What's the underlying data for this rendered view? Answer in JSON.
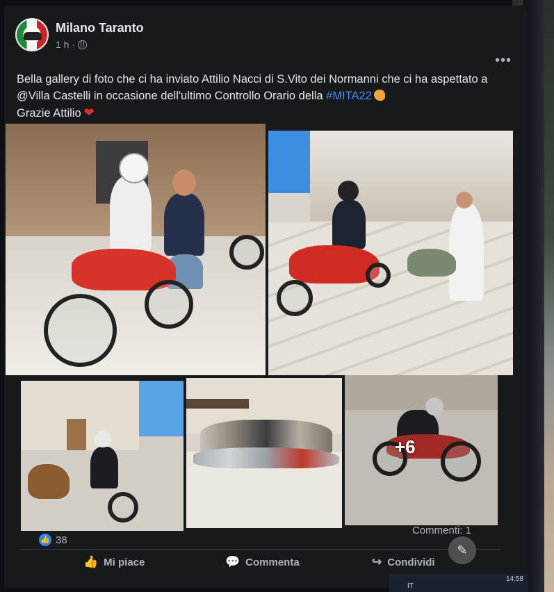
{
  "post": {
    "page_name": "Milano Taranto",
    "time": "1 h",
    "separator": "·",
    "more": "•••",
    "text_part1": "Bella gallery di foto che ci ha inviato Attilio Nacci di S.Vito dei Normanni che ci ha aspettato a @Villa Castelli in occasione dell'ultimo Controllo Orario della ",
    "hashtag": "#MITA22",
    "text_part2": "Grazie Attilio"
  },
  "gallery": {
    "more_photos": "+6"
  },
  "stats": {
    "likes": "38",
    "comments": "Commenti: 1"
  },
  "actions": {
    "like": "Mi piace",
    "comment": "Commenta",
    "share": "Condividi"
  },
  "taskbar": {
    "lang": "IT",
    "time": "14:58"
  },
  "colors": {
    "background": "#18191c",
    "hashtag": "#4a8cff",
    "like_badge": "#2d88ff"
  }
}
